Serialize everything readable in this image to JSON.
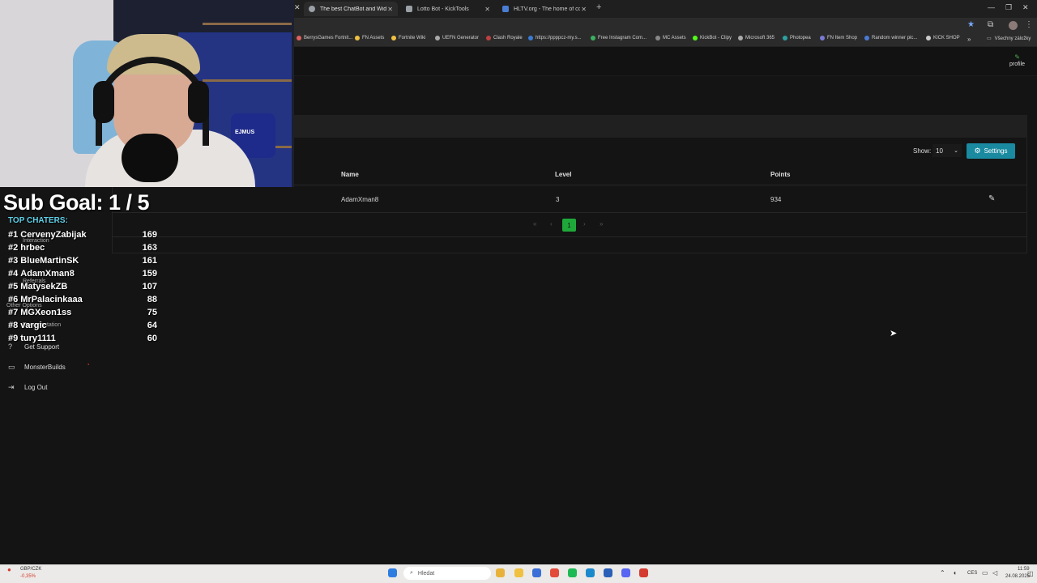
{
  "browser": {
    "tabs": [
      {
        "title": "The best ChatBot and Widgets",
        "color": "#9aa0a6"
      },
      {
        "title": "Lotto Bot - KickTools",
        "color": "#9aa0a6"
      },
      {
        "title": "HLTV.org - The home of comp",
        "color": "#4a7dd4"
      }
    ],
    "new_tab": "+",
    "bookmarks": [
      {
        "label": "BerrysGames Fortnit...",
        "color": "#e06060"
      },
      {
        "label": "FN Assets",
        "color": "#f0c040"
      },
      {
        "label": "Fortnite Wiki",
        "color": "#f0c040"
      },
      {
        "label": "UEFN Generator",
        "color": "#aaaaaa"
      },
      {
        "label": "Clash Royale",
        "color": "#c04040"
      },
      {
        "label": "https://ppppcz-my.s...",
        "color": "#3a7ad4"
      },
      {
        "label": "Free Instagram Com...",
        "color": "#3bb060"
      },
      {
        "label": "MC Assets",
        "color": "#888888"
      },
      {
        "label": "KickBot - Clipy",
        "color": "#53fc18"
      },
      {
        "label": "Microsoft 365",
        "color": "#aaaaaa"
      },
      {
        "label": "Photopea",
        "color": "#2aa2a2"
      },
      {
        "label": "FN Item Shop",
        "color": "#7a7ad4"
      },
      {
        "label": "Random winner pic...",
        "color": "#4a7ad4"
      },
      {
        "label": "KICK SHOP",
        "color": "#cccccc"
      }
    ],
    "bookmarks_overflow": "»",
    "all_bookmarks": "Všechny záložky"
  },
  "app": {
    "profile_label": "profile"
  },
  "table": {
    "show_label": "Show:",
    "show_value": "10",
    "settings_label": "Settings",
    "headers": {
      "name": "Name",
      "level": "Level",
      "points": "Points"
    },
    "rows": [
      {
        "name": "AdamXman8",
        "level": "3",
        "points": "934"
      }
    ],
    "pager": {
      "first": "«",
      "prev": "‹",
      "current": "1",
      "next": "›",
      "last": "»"
    }
  },
  "sidebar": {
    "faint": [
      "Interaction",
      "Referrals",
      "Other Options",
      "Documentation"
    ],
    "get_support": "Get Support",
    "monster_builds": "MonsterBuilds",
    "log_out": "Log Out"
  },
  "overlay": {
    "webcam_label": "EJMUS",
    "sub_goal": "Sub Goal:  1 / 5",
    "top_chatters_title": "TOP CHATERS:",
    "chatters": [
      {
        "rank": "#1",
        "name": "CervenyZabijak",
        "score": "169"
      },
      {
        "rank": "#2",
        "name": "hrbec",
        "score": "163"
      },
      {
        "rank": "#3",
        "name": "BlueMartinSK",
        "score": "161"
      },
      {
        "rank": "#4",
        "name": "AdamXman8",
        "score": "159"
      },
      {
        "rank": "#5",
        "name": "MatysekZB",
        "score": "107"
      },
      {
        "rank": "#6",
        "name": "MrPalacinkaaa",
        "score": "88"
      },
      {
        "rank": "#7",
        "name": "MGXeon1ss",
        "score": "75"
      },
      {
        "rank": "#8",
        "name": "vargic",
        "score": "64"
      },
      {
        "rank": "#9",
        "name": "tury1111",
        "score": "60"
      }
    ]
  },
  "taskbar": {
    "ticker_pair": "GBP/CZK",
    "ticker_change": "-0,35%",
    "search_placeholder": "Hledat",
    "lang": "CES",
    "time": "11:59",
    "date": "24.08.2025",
    "apps": [
      {
        "name": "windows",
        "color": "#2d7de0"
      },
      {
        "name": "files",
        "color": "#e8b23a"
      },
      {
        "name": "explorer",
        "color": "#f0c040"
      },
      {
        "name": "photos",
        "color": "#3a6fd8"
      },
      {
        "name": "chrome",
        "color": "#e24a3a"
      },
      {
        "name": "spotify",
        "color": "#1db954"
      },
      {
        "name": "edge",
        "color": "#1a8acc"
      },
      {
        "name": "store",
        "color": "#2a5fb8"
      },
      {
        "name": "discord",
        "color": "#5865f2"
      },
      {
        "name": "recorder",
        "color": "#d43a2f"
      }
    ]
  }
}
